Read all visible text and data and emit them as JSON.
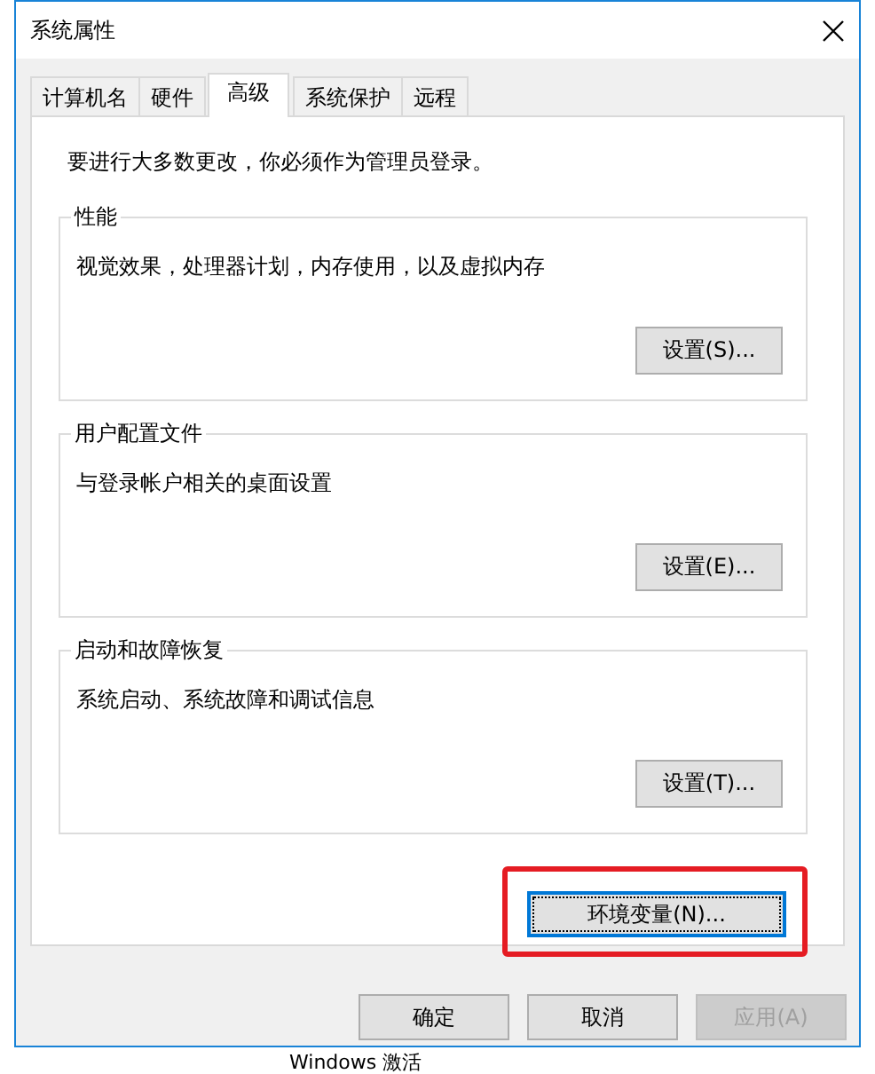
{
  "window": {
    "title": "系统属性"
  },
  "tabs": [
    {
      "label": "计算机名",
      "selected": false
    },
    {
      "label": "硬件",
      "selected": false
    },
    {
      "label": "高级",
      "selected": true
    },
    {
      "label": "系统保护",
      "selected": false
    },
    {
      "label": "远程",
      "selected": false
    }
  ],
  "notice": "要进行大多数更改，你必须作为管理员登录。",
  "groups": [
    {
      "title": "性能",
      "description": "视觉效果，处理器计划，内存使用，以及虚拟内存",
      "button": "设置(S)..."
    },
    {
      "title": "用户配置文件",
      "description": "与登录帐户相关的桌面设置",
      "button": "设置(E)..."
    },
    {
      "title": "启动和故障恢复",
      "description": "系统启动、系统故障和调试信息",
      "button": "设置(T)..."
    }
  ],
  "environment_button": {
    "label": "环境变量(N)...",
    "focused": true,
    "highlighted": true
  },
  "footer_buttons": [
    {
      "label": "确定",
      "disabled": false
    },
    {
      "label": "取消",
      "disabled": false
    },
    {
      "label": "应用(A)",
      "disabled": true
    }
  ],
  "background_text": "Windows 激活"
}
